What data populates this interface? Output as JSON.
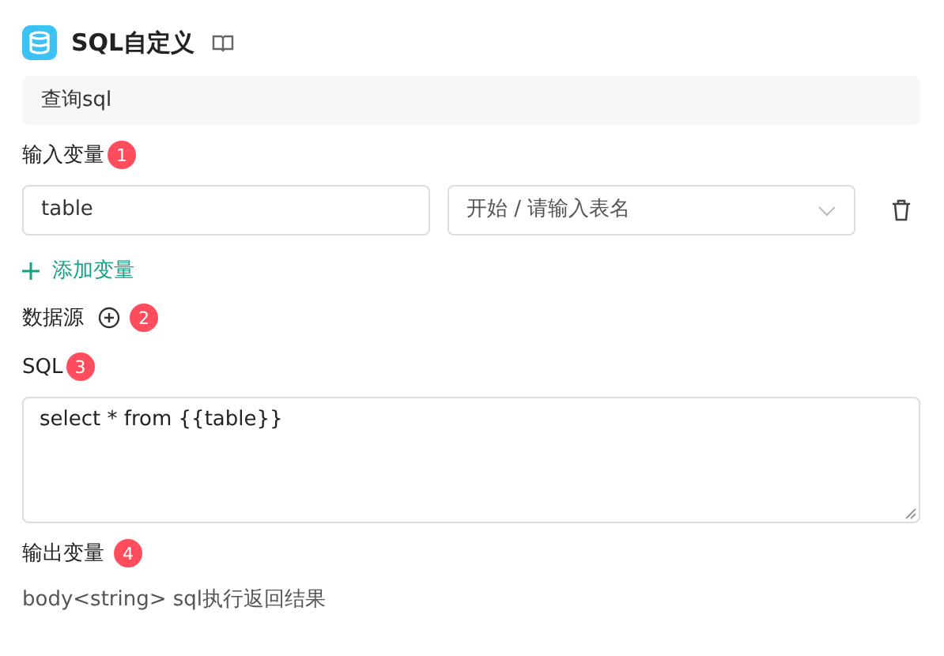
{
  "header": {
    "title": "SQL自定义"
  },
  "description": {
    "value": "查询sql"
  },
  "input_variables": {
    "label": "输入变量",
    "badge": "1",
    "add_button": "添加变量",
    "rows": [
      {
        "name": "table",
        "source": "开始 / 请输入表名"
      }
    ]
  },
  "datasource": {
    "label": "数据源",
    "badge": "2"
  },
  "sql": {
    "label": "SQL",
    "badge": "3",
    "value": "select * from {{table}}"
  },
  "output_variables": {
    "label": "输出变量",
    "badge": "4",
    "text": "body<string> sql执行返回结果"
  }
}
